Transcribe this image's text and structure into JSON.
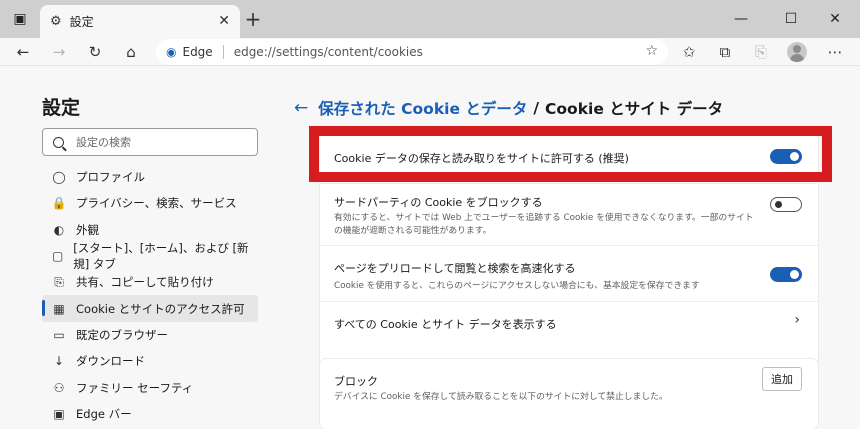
{
  "tab": {
    "title": "設定",
    "close": "✕"
  },
  "window_controls": {
    "minimize": "—",
    "maximize": "☐",
    "close": "✕"
  },
  "newtab": "+",
  "toolbar": {
    "back": "←",
    "forward": "→",
    "refresh": "↻",
    "home": "⌂"
  },
  "address": {
    "brand": "Edge",
    "url": "edge://settings/content/cookies"
  },
  "sidebar": {
    "title": "設定",
    "search_placeholder": "設定の検索",
    "items": [
      {
        "label": "プロファイル",
        "icon": "person-icon",
        "glyph": "◯"
      },
      {
        "label": "プライバシー、検索、サービス",
        "icon": "lock-icon",
        "glyph": "🔒"
      },
      {
        "label": "外観",
        "icon": "appearance-icon",
        "glyph": "◐"
      },
      {
        "label": "[スタート]、[ホーム]、および [新規] タブ",
        "icon": "home-tab-icon",
        "glyph": "▢"
      },
      {
        "label": "共有、コピーして貼り付け",
        "icon": "share-icon",
        "glyph": "⎘"
      },
      {
        "label": "Cookie とサイトのアクセス許可",
        "icon": "site-permissions-icon",
        "glyph": "▦",
        "active": true
      },
      {
        "label": "既定のブラウザー",
        "icon": "browser-icon",
        "glyph": "▭"
      },
      {
        "label": "ダウンロード",
        "icon": "download-icon",
        "glyph": "↓"
      },
      {
        "label": "ファミリー セーフティ",
        "icon": "family-icon",
        "glyph": "⚇"
      },
      {
        "label": "Edge バー",
        "icon": "edge-bar-icon",
        "glyph": "▣"
      }
    ]
  },
  "breadcrumb": {
    "back": "←",
    "parent": "保存された Cookie とデータ",
    "separator": "/",
    "current": "Cookie とサイト データ"
  },
  "settings": {
    "allow_cookies": {
      "title": "Cookie データの保存と読み取りをサイトに許可する (推奨)",
      "enabled": true
    },
    "block_third_party": {
      "title": "サードパーティの Cookie をブロックする",
      "desc": "有効にすると、サイトでは Web 上でユーザーを追跡する Cookie を使用できなくなります。一部のサイトの機能が遮断される可能性があります。",
      "enabled": false
    },
    "preload": {
      "title": "ページをプリロードして閲覧と検索を高速化する",
      "desc": "Cookie を使用すると、これらのページにアクセスしない場合にも、基本設定を保存できます",
      "enabled": true
    },
    "see_all": {
      "title": "すべての Cookie とサイト データを表示する",
      "chevron": "›"
    }
  },
  "block": {
    "title": "ブロック",
    "desc": "デバイスに Cookie を保存して読み取ることを以下のサイトに対して禁止しました。",
    "add_label": "追加"
  },
  "colors": {
    "accent": "#1a5fb4",
    "highlight": "#d51c1f"
  }
}
